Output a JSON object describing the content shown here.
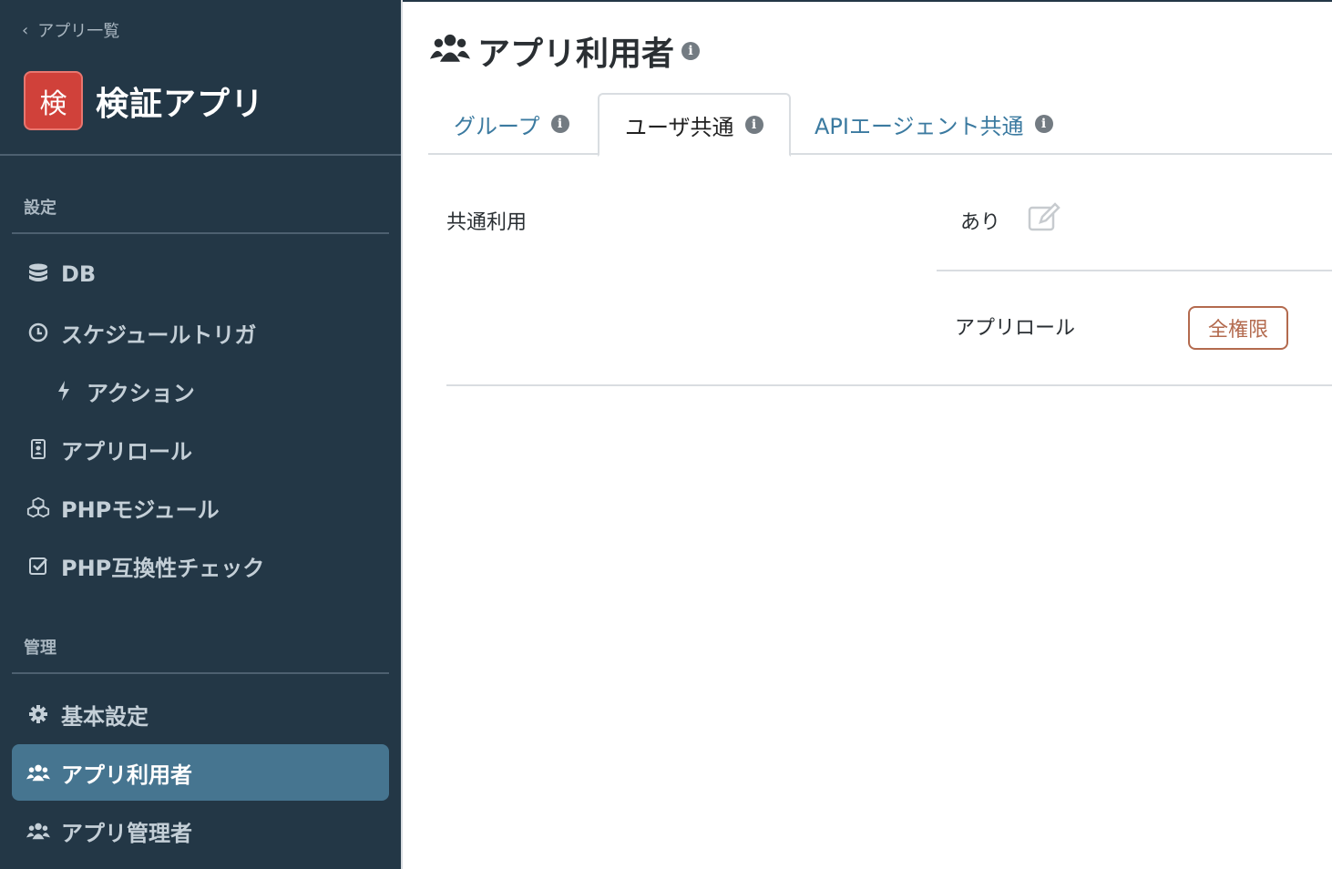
{
  "sidebar": {
    "back_label": "アプリ一覧",
    "app_badge": "検",
    "app_name": "検証アプリ",
    "section_settings": "設定",
    "section_admin": "管理",
    "items": [
      {
        "label": "DB",
        "icon": "database-icon"
      },
      {
        "label": "スケジュールトリガ",
        "icon": "clock-icon"
      },
      {
        "label": "アクション",
        "icon": "bolt-icon"
      },
      {
        "label": "アプリロール",
        "icon": "id-badge-icon"
      },
      {
        "label": "PHPモジュール",
        "icon": "cubes-icon"
      },
      {
        "label": "PHP互換性チェック",
        "icon": "check-square-icon"
      },
      {
        "label": "基本設定",
        "icon": "gear-icon"
      },
      {
        "label": "アプリ利用者",
        "icon": "users-icon",
        "active": true
      },
      {
        "label": "アプリ管理者",
        "icon": "users-icon"
      }
    ]
  },
  "main": {
    "title": "アプリ利用者",
    "tabs": [
      {
        "label": "グループ"
      },
      {
        "label": "ユーザ共通",
        "active": true
      },
      {
        "label": "APIエージェント共通"
      }
    ],
    "shared_use_label": "共通利用",
    "shared_use_value": "あり",
    "app_role_label": "アプリロール",
    "app_role_value": "全権限"
  },
  "colors": {
    "sidebar_bg": "#233746",
    "active_item_bg": "#467590",
    "app_badge_bg": "#d0413a",
    "tab_link": "#3b7aa0",
    "permission_badge": "#b36a4e"
  }
}
